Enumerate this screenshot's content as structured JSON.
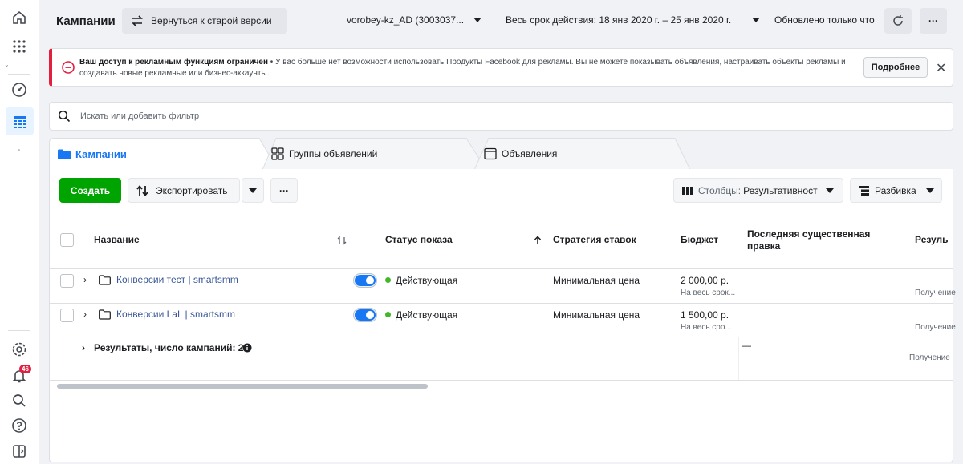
{
  "header": {
    "title": "Кампании",
    "back_label": "Вернуться к старой версии",
    "account": "vorobey-kz_AD (3003037...",
    "date_range": "Весь срок действия: 18 янв 2020 г. – 25 янв 2020 г.",
    "updated": "Обновлено только что",
    "more": "···"
  },
  "alert": {
    "title": "Ваш доступ к рекламным функциям ограничен",
    "message": " • У вас больше нет возможности использовать Продукты Facebook для рекламы. Вы не можете показывать объявления, настраивать объекты рекламы и создавать новые рекламные или бизнес-аккаунты.",
    "button": "Подробнее",
    "close": "✕"
  },
  "search": {
    "placeholder": "Искать или добавить фильтр"
  },
  "tabs": [
    {
      "label": "Кампании"
    },
    {
      "label": "Группы объявлений"
    },
    {
      "label": "Объявления"
    }
  ],
  "toolbar": {
    "create": "Создать",
    "export": "Экспортировать",
    "more": "···",
    "columns_prefix": "Столбцы:",
    "columns_value": "Результативност",
    "breakdown": "Разбивка"
  },
  "table": {
    "columns": {
      "name": "Название",
      "status": "Статус показа",
      "strategy": "Стратегия ставок",
      "budget": "Бюджет",
      "last_edit": "Последняя существенная правка",
      "results": "Резуль"
    },
    "rows": [
      {
        "name": "Конверсии тест | smartsmm",
        "status": "Действующая",
        "strategy": "Минимальная цена",
        "budget": "2 000,00 р.",
        "budget_note": "На весь срок...",
        "results_note": "Получение"
      },
      {
        "name": "Конверсии LaL | smartsmm",
        "status": "Действующая",
        "strategy": "Минимальная цена",
        "budget": "1 500,00 р.",
        "budget_note": "На весь сро...",
        "results_note": "Получение"
      }
    ],
    "summary": {
      "label": "Результаты, число кампаний: 2",
      "last_edit": "—",
      "results_note": "Получение"
    }
  },
  "colors": {
    "accent": "#1877f2",
    "create": "#00a400",
    "alert": "#e41e3f",
    "status_active": "#42b72a",
    "link": "#385898"
  },
  "rail": {
    "notifications_count": "46"
  }
}
